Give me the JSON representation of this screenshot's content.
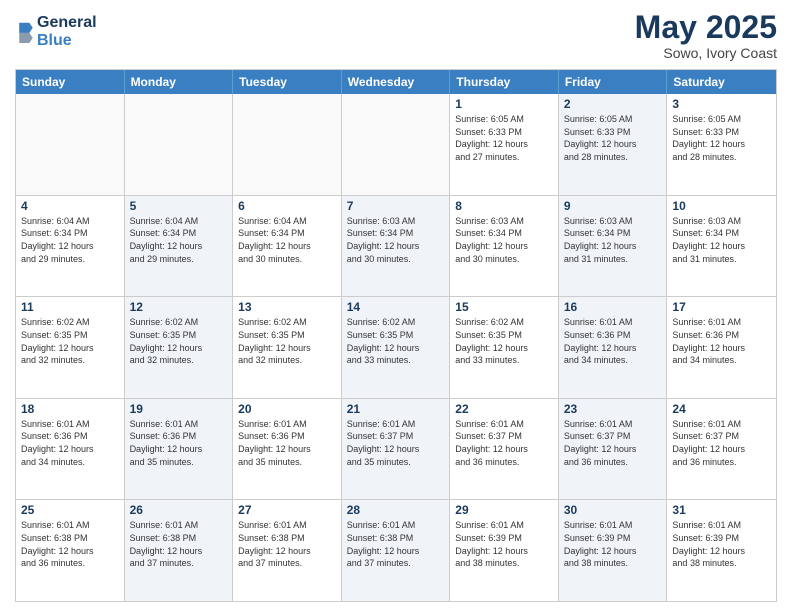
{
  "header": {
    "logo_line1": "General",
    "logo_line2": "Blue",
    "month": "May 2025",
    "location": "Sowo, Ivory Coast"
  },
  "weekdays": [
    "Sunday",
    "Monday",
    "Tuesday",
    "Wednesday",
    "Thursday",
    "Friday",
    "Saturday"
  ],
  "weeks": [
    [
      {
        "day": "",
        "info": "",
        "shaded": false,
        "empty": true
      },
      {
        "day": "",
        "info": "",
        "shaded": false,
        "empty": true
      },
      {
        "day": "",
        "info": "",
        "shaded": false,
        "empty": true
      },
      {
        "day": "",
        "info": "",
        "shaded": false,
        "empty": true
      },
      {
        "day": "1",
        "info": "Sunrise: 6:05 AM\nSunset: 6:33 PM\nDaylight: 12 hours\nand 27 minutes.",
        "shaded": false,
        "empty": false
      },
      {
        "day": "2",
        "info": "Sunrise: 6:05 AM\nSunset: 6:33 PM\nDaylight: 12 hours\nand 28 minutes.",
        "shaded": true,
        "empty": false
      },
      {
        "day": "3",
        "info": "Sunrise: 6:05 AM\nSunset: 6:33 PM\nDaylight: 12 hours\nand 28 minutes.",
        "shaded": false,
        "empty": false
      }
    ],
    [
      {
        "day": "4",
        "info": "Sunrise: 6:04 AM\nSunset: 6:34 PM\nDaylight: 12 hours\nand 29 minutes.",
        "shaded": false,
        "empty": false
      },
      {
        "day": "5",
        "info": "Sunrise: 6:04 AM\nSunset: 6:34 PM\nDaylight: 12 hours\nand 29 minutes.",
        "shaded": true,
        "empty": false
      },
      {
        "day": "6",
        "info": "Sunrise: 6:04 AM\nSunset: 6:34 PM\nDaylight: 12 hours\nand 30 minutes.",
        "shaded": false,
        "empty": false
      },
      {
        "day": "7",
        "info": "Sunrise: 6:03 AM\nSunset: 6:34 PM\nDaylight: 12 hours\nand 30 minutes.",
        "shaded": true,
        "empty": false
      },
      {
        "day": "8",
        "info": "Sunrise: 6:03 AM\nSunset: 6:34 PM\nDaylight: 12 hours\nand 30 minutes.",
        "shaded": false,
        "empty": false
      },
      {
        "day": "9",
        "info": "Sunrise: 6:03 AM\nSunset: 6:34 PM\nDaylight: 12 hours\nand 31 minutes.",
        "shaded": true,
        "empty": false
      },
      {
        "day": "10",
        "info": "Sunrise: 6:03 AM\nSunset: 6:34 PM\nDaylight: 12 hours\nand 31 minutes.",
        "shaded": false,
        "empty": false
      }
    ],
    [
      {
        "day": "11",
        "info": "Sunrise: 6:02 AM\nSunset: 6:35 PM\nDaylight: 12 hours\nand 32 minutes.",
        "shaded": false,
        "empty": false
      },
      {
        "day": "12",
        "info": "Sunrise: 6:02 AM\nSunset: 6:35 PM\nDaylight: 12 hours\nand 32 minutes.",
        "shaded": true,
        "empty": false
      },
      {
        "day": "13",
        "info": "Sunrise: 6:02 AM\nSunset: 6:35 PM\nDaylight: 12 hours\nand 32 minutes.",
        "shaded": false,
        "empty": false
      },
      {
        "day": "14",
        "info": "Sunrise: 6:02 AM\nSunset: 6:35 PM\nDaylight: 12 hours\nand 33 minutes.",
        "shaded": true,
        "empty": false
      },
      {
        "day": "15",
        "info": "Sunrise: 6:02 AM\nSunset: 6:35 PM\nDaylight: 12 hours\nand 33 minutes.",
        "shaded": false,
        "empty": false
      },
      {
        "day": "16",
        "info": "Sunrise: 6:01 AM\nSunset: 6:36 PM\nDaylight: 12 hours\nand 34 minutes.",
        "shaded": true,
        "empty": false
      },
      {
        "day": "17",
        "info": "Sunrise: 6:01 AM\nSunset: 6:36 PM\nDaylight: 12 hours\nand 34 minutes.",
        "shaded": false,
        "empty": false
      }
    ],
    [
      {
        "day": "18",
        "info": "Sunrise: 6:01 AM\nSunset: 6:36 PM\nDaylight: 12 hours\nand 34 minutes.",
        "shaded": false,
        "empty": false
      },
      {
        "day": "19",
        "info": "Sunrise: 6:01 AM\nSunset: 6:36 PM\nDaylight: 12 hours\nand 35 minutes.",
        "shaded": true,
        "empty": false
      },
      {
        "day": "20",
        "info": "Sunrise: 6:01 AM\nSunset: 6:36 PM\nDaylight: 12 hours\nand 35 minutes.",
        "shaded": false,
        "empty": false
      },
      {
        "day": "21",
        "info": "Sunrise: 6:01 AM\nSunset: 6:37 PM\nDaylight: 12 hours\nand 35 minutes.",
        "shaded": true,
        "empty": false
      },
      {
        "day": "22",
        "info": "Sunrise: 6:01 AM\nSunset: 6:37 PM\nDaylight: 12 hours\nand 36 minutes.",
        "shaded": false,
        "empty": false
      },
      {
        "day": "23",
        "info": "Sunrise: 6:01 AM\nSunset: 6:37 PM\nDaylight: 12 hours\nand 36 minutes.",
        "shaded": true,
        "empty": false
      },
      {
        "day": "24",
        "info": "Sunrise: 6:01 AM\nSunset: 6:37 PM\nDaylight: 12 hours\nand 36 minutes.",
        "shaded": false,
        "empty": false
      }
    ],
    [
      {
        "day": "25",
        "info": "Sunrise: 6:01 AM\nSunset: 6:38 PM\nDaylight: 12 hours\nand 36 minutes.",
        "shaded": false,
        "empty": false
      },
      {
        "day": "26",
        "info": "Sunrise: 6:01 AM\nSunset: 6:38 PM\nDaylight: 12 hours\nand 37 minutes.",
        "shaded": true,
        "empty": false
      },
      {
        "day": "27",
        "info": "Sunrise: 6:01 AM\nSunset: 6:38 PM\nDaylight: 12 hours\nand 37 minutes.",
        "shaded": false,
        "empty": false
      },
      {
        "day": "28",
        "info": "Sunrise: 6:01 AM\nSunset: 6:38 PM\nDaylight: 12 hours\nand 37 minutes.",
        "shaded": true,
        "empty": false
      },
      {
        "day": "29",
        "info": "Sunrise: 6:01 AM\nSunset: 6:39 PM\nDaylight: 12 hours\nand 38 minutes.",
        "shaded": false,
        "empty": false
      },
      {
        "day": "30",
        "info": "Sunrise: 6:01 AM\nSunset: 6:39 PM\nDaylight: 12 hours\nand 38 minutes.",
        "shaded": true,
        "empty": false
      },
      {
        "day": "31",
        "info": "Sunrise: 6:01 AM\nSunset: 6:39 PM\nDaylight: 12 hours\nand 38 minutes.",
        "shaded": false,
        "empty": false
      }
    ]
  ]
}
